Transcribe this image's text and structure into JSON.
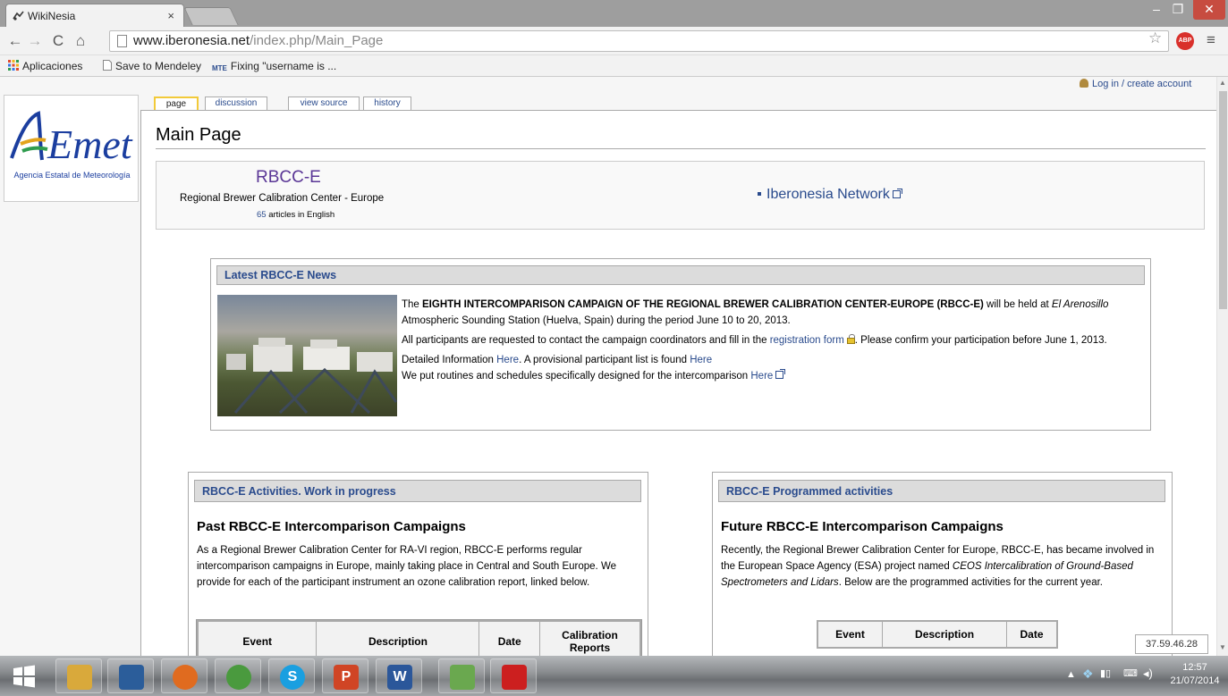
{
  "browser": {
    "tab_title": "WikiNesia",
    "tab_close": "×",
    "window_controls": {
      "minimize": "–",
      "maximize": "❐",
      "close": "✕"
    },
    "url_host": "www.iberonesia.net",
    "url_path": "/index.php/Main_Page",
    "extension": "ABP",
    "icons": {
      "back": "back-arrow-icon",
      "forward": "forward-arrow-icon",
      "reload": "reload-icon",
      "home": "home-icon",
      "star": "star-icon",
      "menu": "hamburger-menu-icon"
    }
  },
  "bookmarks": [
    {
      "label": "Aplicaciones",
      "icon": "apps-grid-icon"
    },
    {
      "label": "Save to Mendeley",
      "icon": "page-icon"
    },
    {
      "label": "Fixing \"username is ...",
      "icon": "mte-icon"
    }
  ],
  "wiki": {
    "personal_link": "Log in / create account",
    "logo_text": "Agencia Estatal de Meteorología",
    "tabs": {
      "page": "page",
      "discussion": "discussion",
      "view_source": "view source",
      "history": "history"
    },
    "page_title": "Main Page",
    "site_name": "RBCC-E",
    "site_subtitle": "Regional Brewer Calibration Center - Europe",
    "article_count": "65",
    "article_count_suffix": " articles in English",
    "network_link": "Iberonesia Network"
  },
  "news": {
    "heading": "Latest RBCC-E News",
    "p1_a": "The ",
    "p1_bold": "EIGHTH INTERCOMPARISON CAMPAIGN OF THE REGIONAL BREWER CALIBRATION CENTER-EUROPE (RBCC-E)",
    "p1_b": " will be held at ",
    "p1_italic": "El Arenosillo",
    "p1_c": " Atmospheric Sounding Station (Huelva, Spain) during the period June 10 to 20, 2013.",
    "p2_a": "All participants are requested to contact the campaign coordinators and fill in the ",
    "p2_link": "registration form",
    "p2_b": ". Please confirm your participation before June 1, 2013.",
    "p3_a": "Detailed Information ",
    "p3_link1": "Here",
    "p3_b": ". A provisional participant list is found ",
    "p3_link2": "Here",
    "p4_a": "We put routines and schedules specifically designed for the intercomparison ",
    "p4_link": "Here"
  },
  "activities": {
    "heading": "RBCC-E Activities. Work in progress",
    "subheading": "Past RBCC-E Intercomparison Campaigns",
    "body": "As a Regional Brewer Calibration Center for RA-VI region, RBCC-E performs regular intercomparison campaigns in Europe, mainly taking place in Central and South Europe. We provide for each of the participant instrument an ozone calibration report, linked below.",
    "table_headers": [
      "Event",
      "Description",
      "Date",
      "Calibration Reports"
    ]
  },
  "programmed": {
    "heading": "RBCC-E Programmed activities",
    "subheading": "Future RBCC-E Intercomparison Campaigns",
    "body_a": "Recently, the Regional Brewer Calibration Center for Europe, RBCC-E, has became involved in the European Space Agency (ESA) project named ",
    "body_italic": "CEOS Intercalibration of Ground-Based Spectrometers and Lidars",
    "body_b": ". Below are the programmed activities for the current year.",
    "table_headers": [
      "Event",
      "Description",
      "Date"
    ]
  },
  "tooltip_ip": "37.59.46.28",
  "taskbar": {
    "apps": [
      {
        "name": "file-explorer-icon",
        "label": "",
        "color": "#d9a93b"
      },
      {
        "name": "remote-desktop-icon",
        "label": "",
        "color": "#2b5d9a"
      },
      {
        "name": "firefox-icon",
        "label": "",
        "color": "#e06b1f"
      },
      {
        "name": "chrome-icon",
        "label": "",
        "color": "#4a9a3e"
      },
      {
        "name": "skype-icon",
        "label": "S",
        "color": "#1a9fe0"
      },
      {
        "name": "powerpoint-icon",
        "label": "P",
        "color": "#d04525"
      },
      {
        "name": "word-icon",
        "label": "W",
        "color": "#2b579a"
      },
      {
        "name": "editor-icon",
        "label": "",
        "color": "#6aa84f"
      },
      {
        "name": "acrobat-icon",
        "label": "",
        "color": "#cc1f1f"
      }
    ],
    "time": "12:57",
    "date": "21/07/2014"
  }
}
